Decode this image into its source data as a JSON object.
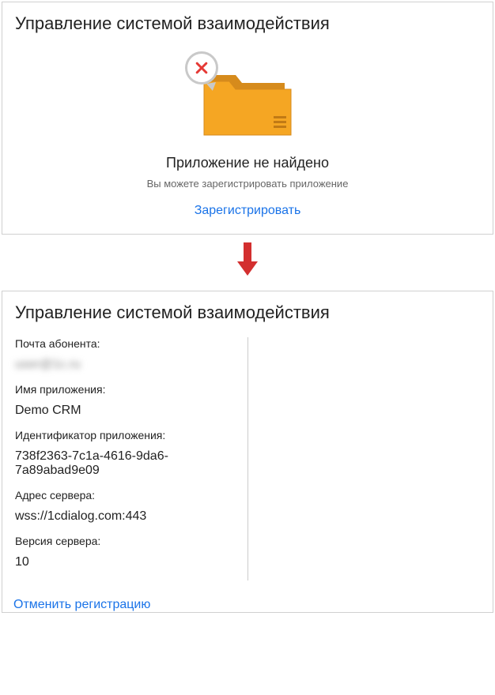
{
  "panel1": {
    "title": "Управление системой взаимодействия",
    "emptyTitle": "Приложение не найдено",
    "emptySub": "Вы можете зарегистрировать приложение",
    "registerLabel": "Зарегистрировать"
  },
  "panel2": {
    "title": "Управление системой взаимодействия",
    "emailLabel": "Почта абонента:",
    "emailValue": "user@1c.ru",
    "appNameLabel": "Имя приложения:",
    "appNameValue": "Demo CRM",
    "appIdLabel": "Идентификатор приложения:",
    "appIdValue": "738f2363-7c1a-4616-9da6-7a89abad9e09",
    "serverAddrLabel": "Адрес сервера:",
    "serverAddrValue": "wss://1cdialog.com:443",
    "serverVerLabel": "Версия сервера:",
    "serverVerValue": "10",
    "cancelLabel": "Отменить регистрацию"
  }
}
